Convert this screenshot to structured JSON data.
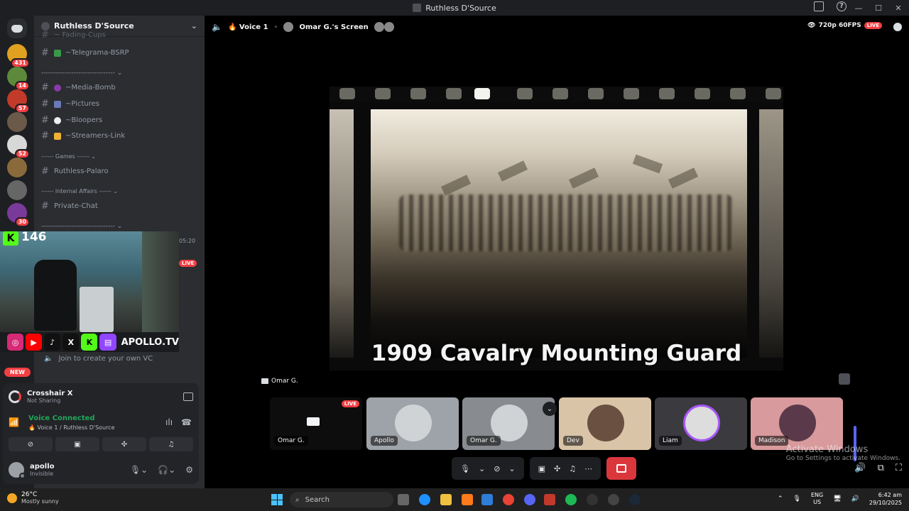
{
  "window": {
    "title": "Ruthless D'Source"
  },
  "servers": [
    {
      "badge": "431",
      "color": "#e0a020"
    },
    {
      "badge": "14",
      "color": "#5d8a3a"
    },
    {
      "badge": "57",
      "color": "#c23a2a"
    },
    {
      "badge": "",
      "color": "#6b5a4a"
    },
    {
      "badge": "52",
      "color": "#d8d8d8"
    },
    {
      "badge": "",
      "color": "#8a6a3a"
    },
    {
      "badge": "",
      "color": "#666"
    },
    {
      "badge": "30",
      "color": "#7a3a9a"
    }
  ],
  "sidebar": {
    "guild_name": "Ruthless D'Source",
    "cut_channel": "~ Fading-Cups",
    "channels_top": [
      "~Telegrama-BSRP"
    ],
    "divider1": "-------------------------------- ⌄",
    "channels_media": [
      "~Media-Bomb",
      "~Pictures",
      "~Bloopers",
      "~Streamers-Link"
    ],
    "cat_games": "------ Games ------ ⌄",
    "channels_games": [
      "Ruthless-Palaro"
    ],
    "cat_internal": "------ Internal Affairs ------ ⌄",
    "channels_internal": [
      "Private-Chat"
    ],
    "divider2": "-------------------------------- ⌄",
    "side_time": "05:20",
    "side_live": "LIVE",
    "join_vc": "Join to create your own VC",
    "new_badge": "NEW"
  },
  "overlay": {
    "kick_count": "146",
    "brand": "APOLLO.TV"
  },
  "panel": {
    "app_title": "Crosshair X",
    "app_status": "Not Sharing",
    "voice_status": "Voice Connected",
    "voice_location": "🔥 Voice 1 / Ruthless D'Source",
    "username": "apollo",
    "user_status": "Invisible"
  },
  "stage": {
    "channel": "🔥 Voice 1",
    "screen_owner": "Omar G.'s Screen",
    "quality": "720p 60FPS",
    "live": "LIVE",
    "caption": "1909 Cavalry Mounting Guard",
    "presenter": "Omar G.",
    "participants": [
      {
        "name": "Omar G.",
        "live": "LIVE",
        "bg": "#0d0d0d"
      },
      {
        "name": "Apollo",
        "bg": "#9ea3a9"
      },
      {
        "name": "Omar G.",
        "bg": "#888c90"
      },
      {
        "name": "Dev",
        "bg": "#d9c4a8"
      },
      {
        "name": "Liam",
        "bg": "#3a3a3f"
      },
      {
        "name": "Madison",
        "bg": "#d89a9c"
      }
    ],
    "activate_title": "Activate Windows",
    "activate_sub": "Go to Settings to activate Windows."
  },
  "taskbar": {
    "temp": "26°C",
    "weather": "Mostly sunny",
    "search": "Search",
    "lang_top": "ENG",
    "lang_bottom": "US",
    "time": "6:42 am",
    "date": "29/10/2025"
  }
}
